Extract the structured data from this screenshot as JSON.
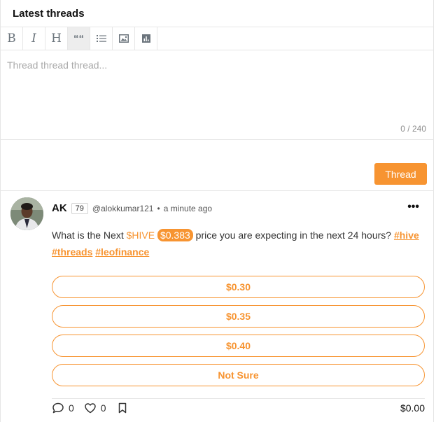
{
  "header": {
    "title": "Latest threads"
  },
  "toolbar": {
    "bold": "B",
    "italic": "I",
    "heading": "H",
    "quote": "““"
  },
  "composer": {
    "placeholder": "Thread thread thread...",
    "counter": "0 / 240",
    "submit_label": "Thread"
  },
  "post": {
    "author": "AK",
    "reputation": "79",
    "handle": "@alokkumar121",
    "separator": "•",
    "time": "a minute ago",
    "more": "•••",
    "text_before": "What is the Next ",
    "ticker": "$HIVE",
    "price": "$0.383",
    "text_after": " price you are expecting in the next 24 hours? ",
    "tags": [
      "#hive",
      "#threads",
      "#leofinance"
    ],
    "poll_options": [
      "$0.30",
      "$0.35",
      "$0.40",
      "Not Sure"
    ],
    "comments_count": "0",
    "likes_count": "0",
    "payout": "$0.00"
  },
  "colors": {
    "accent": "#f79431",
    "border": "#e6e6e6"
  }
}
